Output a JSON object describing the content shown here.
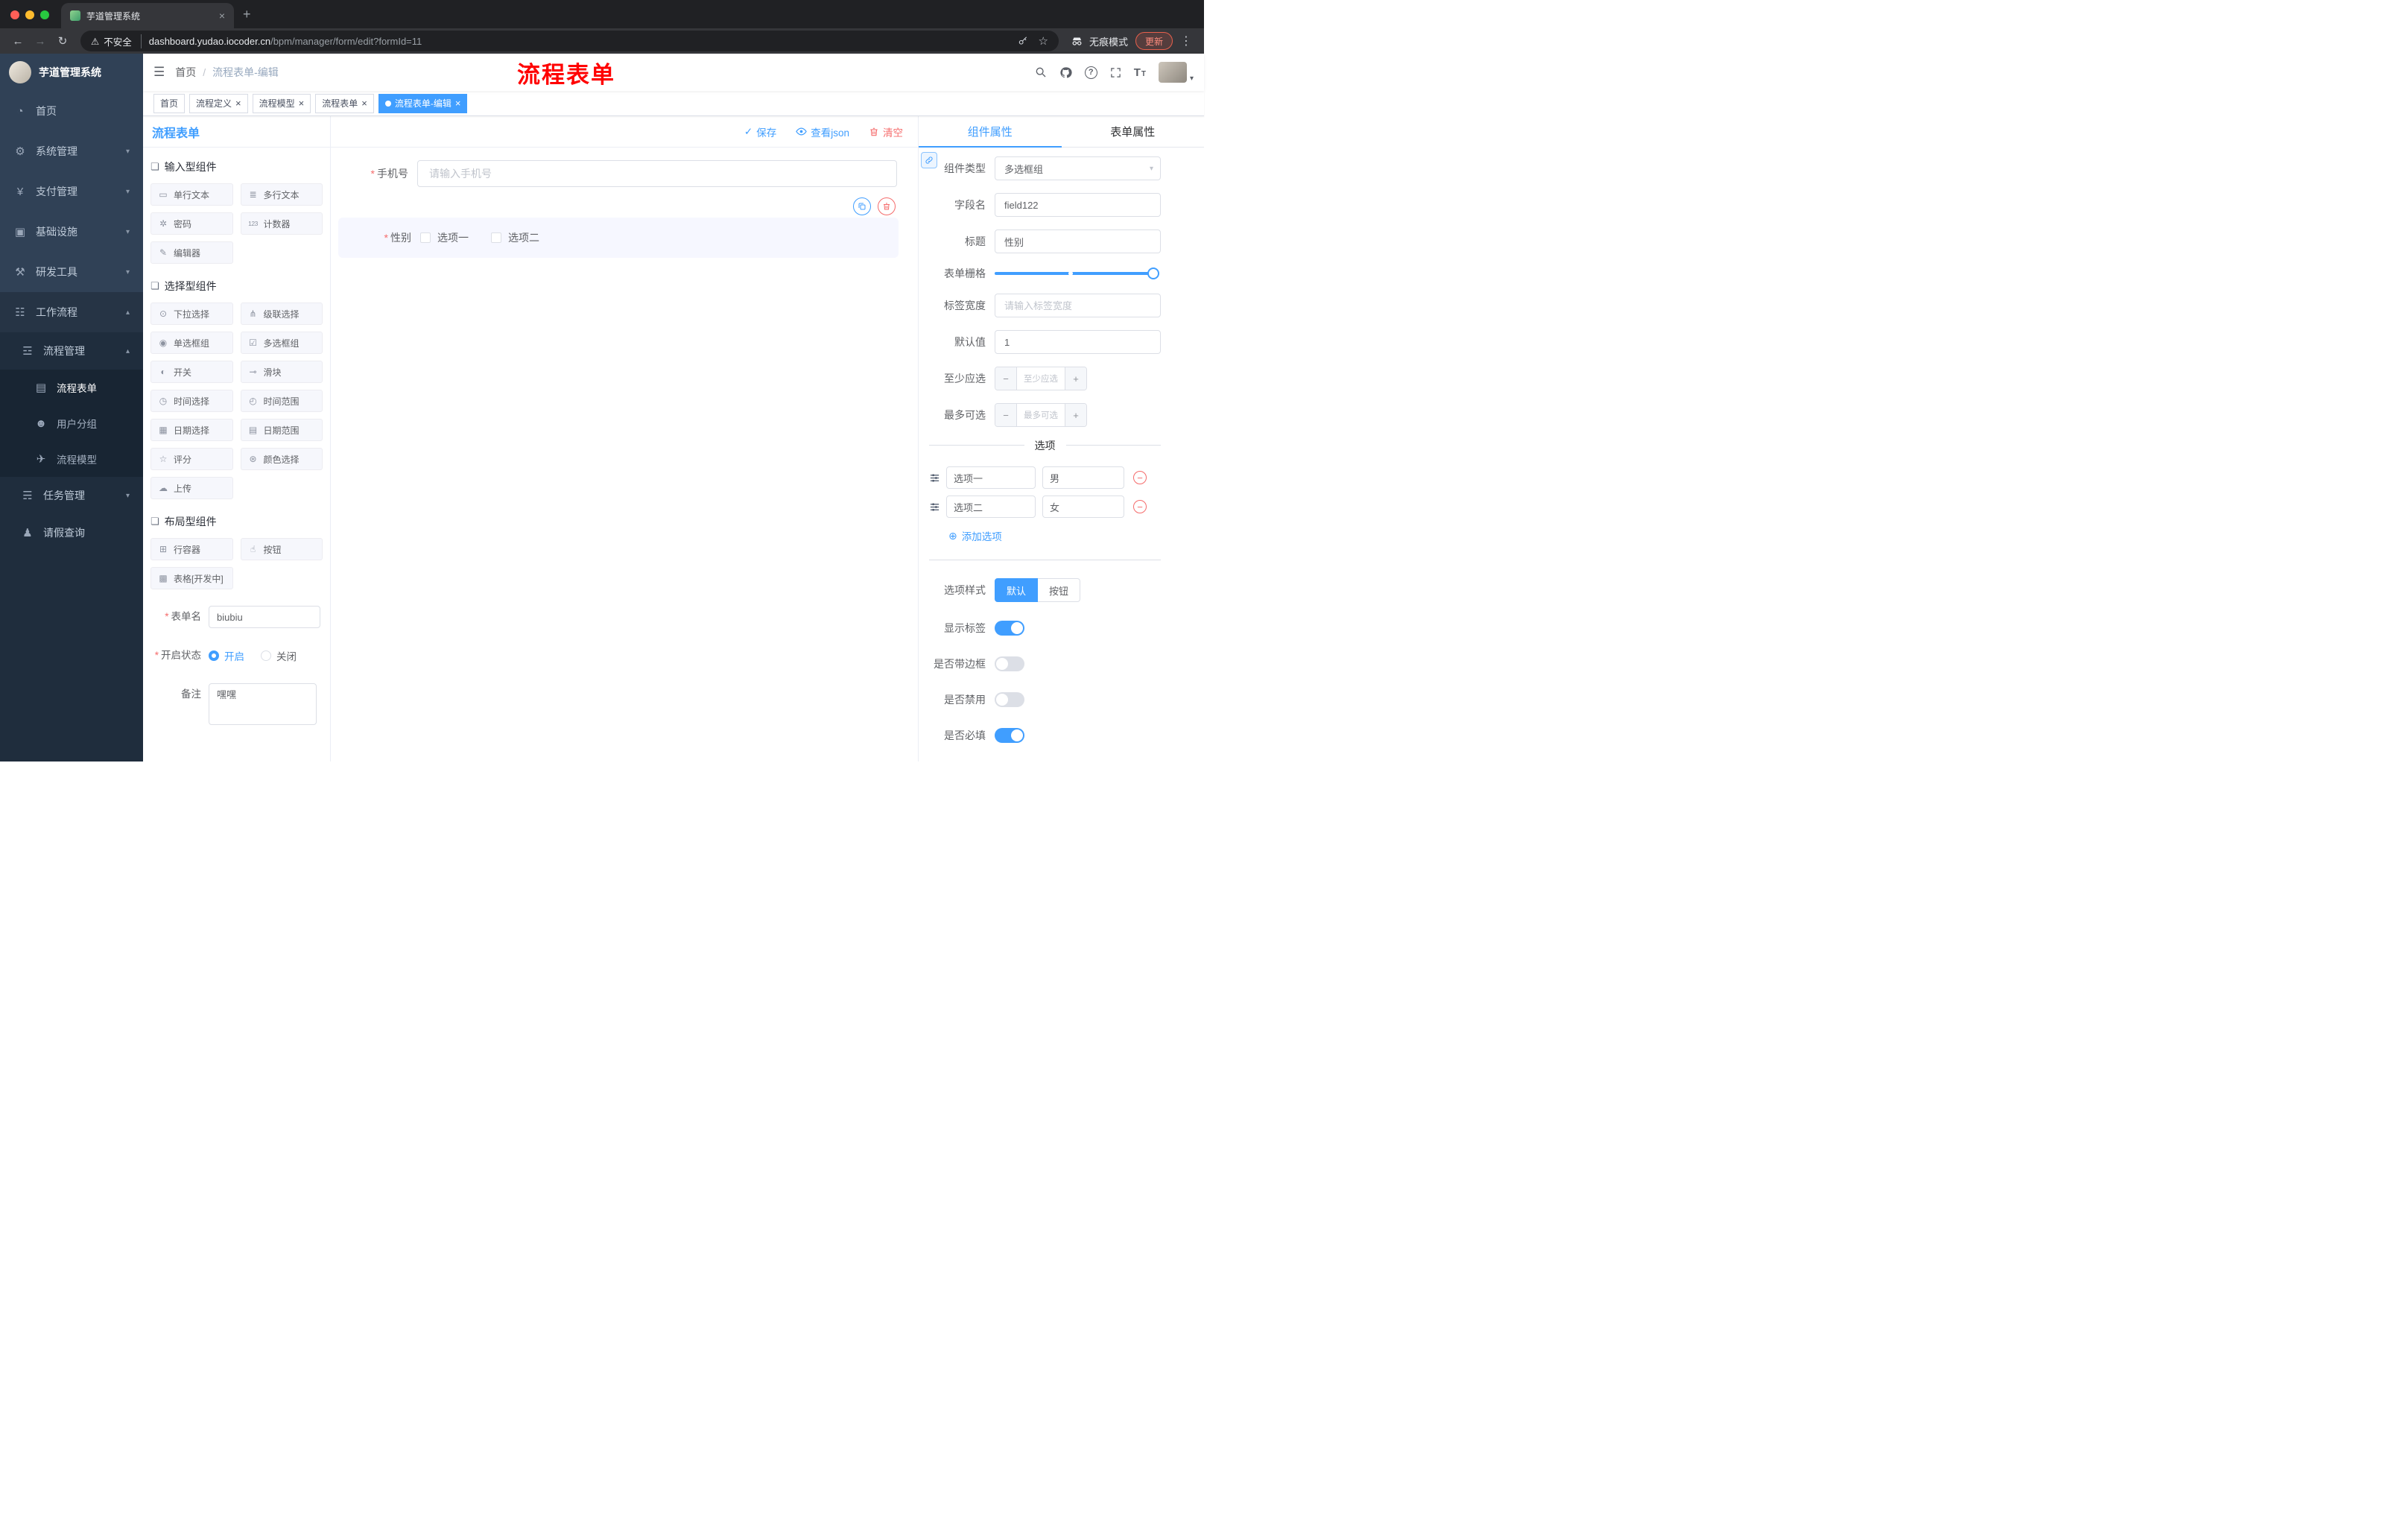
{
  "colors": {
    "primary": "#409eff",
    "danger": "#f56c6c",
    "sidebar_bg": "#304156",
    "submenu_bg": "#1f2d3d",
    "annotation_red": "#ff0000",
    "active_tab_bg": "#409eff"
  },
  "icons": {
    "close": "×",
    "plus": "+",
    "minus": "−",
    "back": "←",
    "forward": "→",
    "reload": "↻",
    "warning": "⚠",
    "star": "☆",
    "kebab": "⋮",
    "hamburger": "☰",
    "caret_down": "▾",
    "check": "✓",
    "required": "*",
    "plus_circle": "⊕",
    "question": "?",
    "font_big": "T",
    "font_small": "T"
  },
  "browser": {
    "tab_title": "芋道管理系统",
    "security_label": "不安全",
    "url_host": "dashboard.yudao.iocoder.cn",
    "url_path": "/bpm/manager/form/edit?formId=11",
    "incognito_label": "无痕模式",
    "update_label": "更新"
  },
  "sidebar": {
    "app_title": "芋道管理系统",
    "items": [
      {
        "label": "首页",
        "glyph": "◔",
        "caret": ""
      },
      {
        "label": "系统管理",
        "glyph": "⚙",
        "caret": "▾"
      },
      {
        "label": "支付管理",
        "glyph": "¥",
        "caret": "▾"
      },
      {
        "label": "基础设施",
        "glyph": "▣",
        "caret": "▾"
      },
      {
        "label": "研发工具",
        "glyph": "⚒",
        "caret": "▾"
      },
      {
        "label": "工作流程",
        "glyph": "☷",
        "caret": "▴"
      }
    ],
    "submenu": {
      "process_mgmt": {
        "label": "流程管理",
        "glyph": "☲",
        "caret": "▴"
      },
      "children": [
        {
          "label": "流程表单",
          "glyph": "▤",
          "active": true
        },
        {
          "label": "用户分组",
          "glyph": "☻",
          "active": false
        },
        {
          "label": "流程模型",
          "glyph": "✈",
          "active": false
        }
      ],
      "task_mgmt": {
        "label": "任务管理",
        "glyph": "☴",
        "caret": "▾"
      },
      "leave_query": {
        "label": "请假查询",
        "glyph": "♟"
      }
    }
  },
  "navbar": {
    "breadcrumb_home": "首页",
    "breadcrumb_sep": "/",
    "breadcrumb_current": "流程表单-编辑",
    "annotation": "流程表单"
  },
  "tags_view": [
    {
      "label": "首页",
      "closable": false,
      "active": false
    },
    {
      "label": "流程定义",
      "closable": true,
      "active": false
    },
    {
      "label": "流程模型",
      "closable": true,
      "active": false
    },
    {
      "label": "流程表单",
      "closable": true,
      "active": false
    },
    {
      "label": "流程表单-编辑",
      "closable": true,
      "active": true
    }
  ],
  "designer": {
    "panel_title": "流程表单",
    "toolbar": {
      "save": "保存",
      "view_json": "查看json",
      "clear": "清空"
    },
    "palette": {
      "groups": [
        {
          "title": "输入型组件",
          "glyph": "❏",
          "items": [
            {
              "label": "单行文本",
              "glyph": "▭"
            },
            {
              "label": "多行文本",
              "glyph": "≣"
            },
            {
              "label": "密码",
              "glyph": "✲"
            },
            {
              "label": "计数器",
              "glyph": "123"
            },
            {
              "label": "编辑器",
              "glyph": "✎"
            }
          ]
        },
        {
          "title": "选择型组件",
          "glyph": "❏",
          "items": [
            {
              "label": "下拉选择",
              "glyph": "⊙"
            },
            {
              "label": "级联选择",
              "glyph": "⋔"
            },
            {
              "label": "单选框组",
              "glyph": "◉"
            },
            {
              "label": "多选框组",
              "glyph": "☑"
            },
            {
              "label": "开关",
              "glyph": "◐"
            },
            {
              "label": "滑块",
              "glyph": "⊸"
            },
            {
              "label": "时间选择",
              "glyph": "◷"
            },
            {
              "label": "时间范围",
              "glyph": "◴"
            },
            {
              "label": "日期选择",
              "glyph": "▦"
            },
            {
              "label": "日期范围",
              "glyph": "▤"
            },
            {
              "label": "评分",
              "glyph": "☆"
            },
            {
              "label": "颜色选择",
              "glyph": "⊛"
            },
            {
              "label": "上传",
              "glyph": "☁"
            }
          ]
        },
        {
          "title": "布局型组件",
          "glyph": "❏",
          "items": [
            {
              "label": "行容器",
              "glyph": "⊞"
            },
            {
              "label": "按钮",
              "glyph": "☝"
            },
            {
              "label": "表格[开发中]",
              "glyph": "▩"
            }
          ]
        }
      ]
    },
    "meta": {
      "form_name_label": "表单名",
      "form_name_value": "biubiu",
      "status_label": "开启状态",
      "status_on": "开启",
      "status_off": "关闭",
      "remark_label": "备注",
      "remark_value": "嘿嘿"
    },
    "canvas": {
      "phone_label": "手机号",
      "phone_placeholder": "请输入手机号",
      "gender_label": "性别",
      "gender_options": [
        "选项一",
        "选项二"
      ]
    }
  },
  "properties": {
    "tab_component": "组件属性",
    "tab_form": "表单属性",
    "component_type_label": "组件类型",
    "component_type_value": "多选框组",
    "field_name_label": "字段名",
    "field_name_value": "field122",
    "title_label": "标题",
    "title_value": "性别",
    "grid_label": "表单栅格",
    "label_width_label": "标签宽度",
    "label_width_placeholder": "请输入标签宽度",
    "default_label": "默认值",
    "default_value": "1",
    "min_label": "至少应选",
    "min_placeholder": "至少应选",
    "max_label": "最多可选",
    "max_placeholder": "最多可选",
    "options_divider": "选项",
    "options": [
      {
        "label": "选项一",
        "value": "男"
      },
      {
        "label": "选项二",
        "value": "女"
      }
    ],
    "add_option": "添加选项",
    "style_label": "选项样式",
    "style_default": "默认",
    "style_button": "按钮",
    "switches": [
      {
        "label": "显示标签",
        "on": true
      },
      {
        "label": "是否带边框",
        "on": false
      },
      {
        "label": "是否禁用",
        "on": false
      },
      {
        "label": "是否必填",
        "on": true
      }
    ]
  }
}
